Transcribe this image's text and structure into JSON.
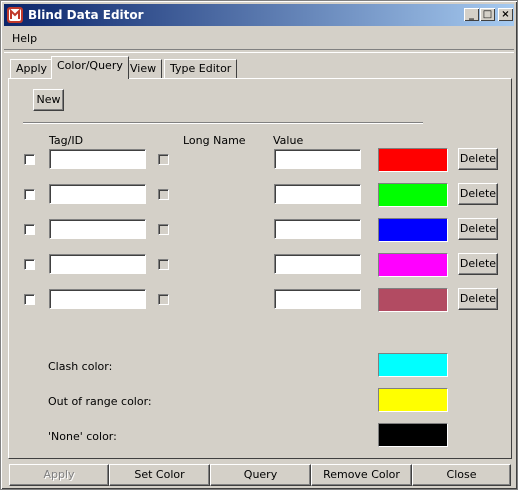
{
  "window": {
    "title": "Blind Data Editor"
  },
  "menu": {
    "help": "Help"
  },
  "title_buttons": {
    "minimize": "_",
    "maximize": "□",
    "close": "×"
  },
  "tabs": [
    {
      "label": "Apply",
      "active": false
    },
    {
      "label": "Color/Query",
      "active": true
    },
    {
      "label": "View",
      "active": false
    },
    {
      "label": "Type Editor",
      "active": false
    }
  ],
  "panel": {
    "new_label": "New",
    "headers": {
      "tag_id": "Tag/ID",
      "long_name": "Long Name",
      "value": "Value"
    },
    "rows": [
      {
        "tag": "",
        "value": "",
        "color": "#ff0000",
        "delete_label": "Delete"
      },
      {
        "tag": "",
        "value": "",
        "color": "#00ff00",
        "delete_label": "Delete"
      },
      {
        "tag": "",
        "value": "",
        "color": "#0000ff",
        "delete_label": "Delete"
      },
      {
        "tag": "",
        "value": "",
        "color": "#ff00ff",
        "delete_label": "Delete"
      },
      {
        "tag": "",
        "value": "",
        "color": "#b24b62",
        "delete_label": "Delete"
      }
    ],
    "special_colors": [
      {
        "label": "Clash color:",
        "color": "#00ffff"
      },
      {
        "label": "Out of range color:",
        "color": "#ffff00"
      },
      {
        "label": "'None' color:",
        "color": "#000000"
      }
    ]
  },
  "bottom_buttons": {
    "apply": "Apply",
    "set_color": "Set Color",
    "query": "Query",
    "remove_color": "Remove Color",
    "close": "Close"
  },
  "colors": {
    "face": "#d4d0c8",
    "title_start": "#0a246a",
    "title_end": "#a6caf0"
  }
}
